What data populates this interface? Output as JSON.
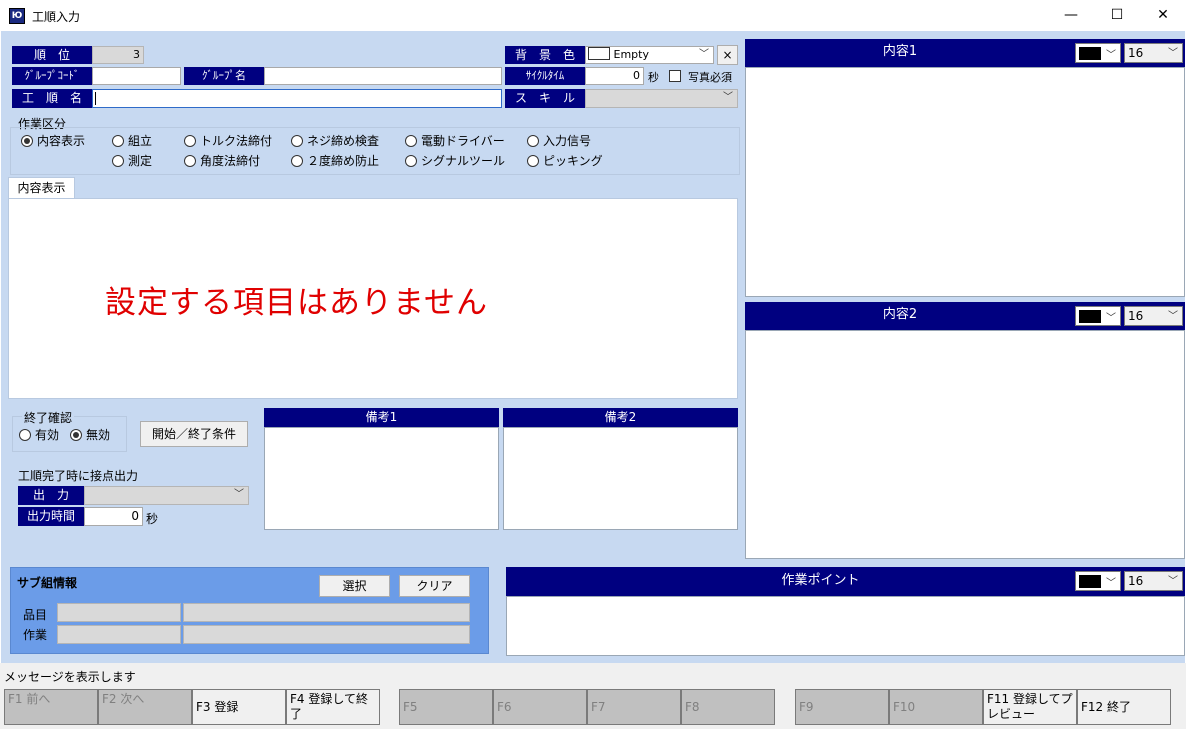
{
  "window": {
    "title": "工順入力",
    "icon_label": "Ю",
    "minimize": "—",
    "maximize": "☐",
    "close": "✕"
  },
  "top_form": {
    "order_label": "順　位",
    "order_value": "3",
    "group_code_label": "ｸﾞﾙｰﾌﾟｺｰﾄﾞ",
    "group_code_value": "",
    "group_name_label": "ｸﾞﾙｰﾌﾟ名",
    "group_name_value": "",
    "process_name_label": "工　順　名",
    "process_name_value": "",
    "bg_color_label": "背　景　色",
    "bg_color_value": "Empty",
    "bg_clear_button": "×",
    "cycle_time_label": "ｻｲｸﾙﾀｲﾑ",
    "cycle_time_value": "0",
    "cycle_time_unit": "秒",
    "photo_required_label": "写真必須",
    "photo_required_checked": false,
    "skill_label": "ス　キ　ル",
    "skill_value": ""
  },
  "work_type": {
    "label": "作業区分",
    "options": [
      {
        "label": "内容表示",
        "selected": true
      },
      {
        "label": "組立",
        "selected": false
      },
      {
        "label": "トルク法締付",
        "selected": false
      },
      {
        "label": "ネジ締め検査",
        "selected": false
      },
      {
        "label": "電動ドライバー",
        "selected": false
      },
      {
        "label": "入力信号",
        "selected": false
      },
      {
        "label": "測定",
        "selected": false
      },
      {
        "label": "角度法締付",
        "selected": false
      },
      {
        "label": "２度締め防止",
        "selected": false
      },
      {
        "label": "シグナルツール",
        "selected": false
      },
      {
        "label": "ピッキング",
        "selected": false
      }
    ]
  },
  "content_tab": {
    "tab_label": "内容表示",
    "message": "設定する項目はありません"
  },
  "end_confirm": {
    "label": "終了確認",
    "enabled_label": "有効",
    "disabled_label": "無効",
    "selected": "無効",
    "condition_button": "開始／終了条件"
  },
  "output": {
    "section_label": "工順完了時に接点出力",
    "output_label": "出　力",
    "output_value": "",
    "time_label": "出力時間",
    "time_value": "0",
    "time_unit": "秒"
  },
  "notes": {
    "note1_title": "備考1",
    "note2_title": "備考2"
  },
  "right_panels": {
    "content1_title": "内容1",
    "content1_size": "16",
    "content2_title": "内容2",
    "content2_size": "16",
    "color_value": "#000000"
  },
  "sub_assembly": {
    "title": "サブ組情報",
    "select_button": "選択",
    "clear_button": "クリア",
    "item_label": "品目",
    "work_label": "作業"
  },
  "work_point": {
    "title": "作業ポイント",
    "size": "16"
  },
  "status": {
    "message": "メッセージを表示します"
  },
  "fkeys": [
    {
      "label": "F1 前へ",
      "enabled": false
    },
    {
      "label": "F2 次へ",
      "enabled": false
    },
    {
      "label": "F3 登録",
      "enabled": true
    },
    {
      "label": "F4 登録して終了",
      "enabled": true
    },
    {
      "label": "F5",
      "enabled": false
    },
    {
      "label": "F6",
      "enabled": false
    },
    {
      "label": "F7",
      "enabled": false
    },
    {
      "label": "F8",
      "enabled": false
    },
    {
      "label": "F9",
      "enabled": false
    },
    {
      "label": "F10",
      "enabled": false
    },
    {
      "label": "F11 登録してプレビュー",
      "enabled": true
    },
    {
      "label": "F12 終了",
      "enabled": true
    }
  ],
  "colors": {
    "navy": "#000080",
    "client_bg": "#c7d9f1",
    "message_red": "#e00000",
    "sub_panel": "#6b9ce8"
  }
}
